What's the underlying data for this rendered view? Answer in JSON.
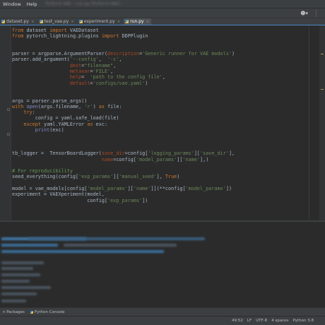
{
  "menu": {
    "items": [
      "Window",
      "Help"
    ],
    "title": "PyTorch-VAE – run.py [PyTorch-VAE]"
  },
  "tabs": [
    {
      "label": "dataset.py",
      "active": false
    },
    {
      "label": "test_vae.py",
      "active": false
    },
    {
      "label": "experiment.py",
      "active": false
    },
    {
      "label": "run.py",
      "active": true
    }
  ],
  "code_lines": [
    [
      [
        "kw",
        "from"
      ],
      [
        "fn",
        " dataset "
      ],
      [
        "kw",
        "import"
      ],
      [
        "fn",
        " VAEDataset"
      ]
    ],
    [
      [
        "kw",
        "from"
      ],
      [
        "fn",
        " pytorch_lightning.plugins "
      ],
      [
        "kw",
        "import"
      ],
      [
        "fn",
        " DDPPlugin"
      ]
    ],
    [],
    [],
    [
      [
        "fn",
        "parser = argparse.ArgumentParser("
      ],
      [
        "param",
        "description"
      ],
      [
        "fn",
        "="
      ],
      [
        "str",
        "'Generic runner for VAE models'"
      ],
      [
        "fn",
        ")"
      ]
    ],
    [
      [
        "fn",
        "parser.add_argument("
      ],
      [
        "str",
        "'--config'"
      ],
      [
        "fn",
        ",  "
      ],
      [
        "str",
        "'-c'"
      ],
      [
        "fn",
        ","
      ]
    ],
    [
      [
        "fn",
        "                    "
      ],
      [
        "param",
        "dest"
      ],
      [
        "fn",
        "="
      ],
      [
        "str",
        "\"filename\""
      ],
      [
        "fn",
        ","
      ]
    ],
    [
      [
        "fn",
        "                    "
      ],
      [
        "param",
        "metavar"
      ],
      [
        "fn",
        "="
      ],
      [
        "str",
        "'FILE'"
      ],
      [
        "fn",
        ","
      ]
    ],
    [
      [
        "fn",
        "                    "
      ],
      [
        "param",
        "help"
      ],
      [
        "fn",
        "=  "
      ],
      [
        "str",
        "'path to the config file'"
      ],
      [
        "fn",
        ","
      ]
    ],
    [
      [
        "fn",
        "                    "
      ],
      [
        "param",
        "default"
      ],
      [
        "fn",
        "="
      ],
      [
        "str",
        "'configs/vae.yaml'"
      ],
      [
        "fn",
        ")"
      ]
    ],
    [],
    [],
    [
      [
        "fn",
        "args = parser.parse_args()"
      ]
    ],
    [
      [
        "kw",
        "with"
      ],
      [
        "builtin",
        " open"
      ],
      [
        "fn",
        "(args.filename, "
      ],
      [
        "str",
        "'r'"
      ],
      [
        "fn",
        ") "
      ],
      [
        "kw",
        "as"
      ],
      [
        "fn",
        " file:"
      ]
    ],
    [
      [
        "kw",
        "    try"
      ],
      [
        "fn",
        ":"
      ]
    ],
    [
      [
        "fn",
        "        config = yaml.safe_load(file)"
      ]
    ],
    [
      [
        "kw",
        "    except"
      ],
      [
        "fn",
        " yaml.YAMLError "
      ],
      [
        "kw",
        "as"
      ],
      [
        "fn",
        " exc:"
      ]
    ],
    [
      [
        "builtin",
        "        print"
      ],
      [
        "fn",
        "(exc)"
      ]
    ],
    [],
    [],
    [],
    [
      [
        "fn",
        "tb_logger =  TensorBoardLogger("
      ],
      [
        "param",
        "save_dir"
      ],
      [
        "fn",
        "=config["
      ],
      [
        "str",
        "'logging_params'"
      ],
      [
        "fn",
        "]["
      ],
      [
        "str",
        "'save_dir'"
      ],
      [
        "fn",
        "],"
      ]
    ],
    [
      [
        "fn",
        "                               "
      ],
      [
        "param",
        "name"
      ],
      [
        "fn",
        "=config["
      ],
      [
        "str",
        "'model_params'"
      ],
      [
        "fn",
        "]["
      ],
      [
        "str",
        "'name'"
      ],
      [
        "fn",
        "],)"
      ]
    ],
    [],
    [
      [
        "cmt",
        "# For reproducibility"
      ]
    ],
    [
      [
        "fn",
        "seed_everything(config["
      ],
      [
        "str",
        "'exp_params'"
      ],
      [
        "fn",
        "]["
      ],
      [
        "str",
        "'manual_seed'"
      ],
      [
        "fn",
        "], "
      ],
      [
        "kw",
        "True"
      ],
      [
        "fn",
        ")"
      ]
    ],
    [],
    [
      [
        "fn",
        "model = vae_models[config["
      ],
      [
        "str",
        "'model_params'"
      ],
      [
        "fn",
        "]["
      ],
      [
        "str",
        "'name'"
      ],
      [
        "fn",
        "]](**config["
      ],
      [
        "str",
        "'model_params'"
      ],
      [
        "fn",
        "])"
      ]
    ],
    [
      [
        "fn",
        "experiment = VAEXperiment(model,"
      ]
    ],
    [
      [
        "fn",
        "                          config["
      ],
      [
        "str",
        "'exp_params'"
      ],
      [
        "fn",
        "])"
      ]
    ]
  ],
  "tool_tabs": [
    "n Packages",
    "Python Console"
  ],
  "status": {
    "position": "49:52",
    "line_sep": "LF",
    "encoding": "UTF-8",
    "indent": "4 spaces",
    "interpreter": "Python 3.8"
  },
  "colors": {
    "background": "#2b2b2b",
    "keyword": "#cc7832",
    "string": "#6a8759",
    "param": "#aa4926",
    "comment": "#629755"
  }
}
